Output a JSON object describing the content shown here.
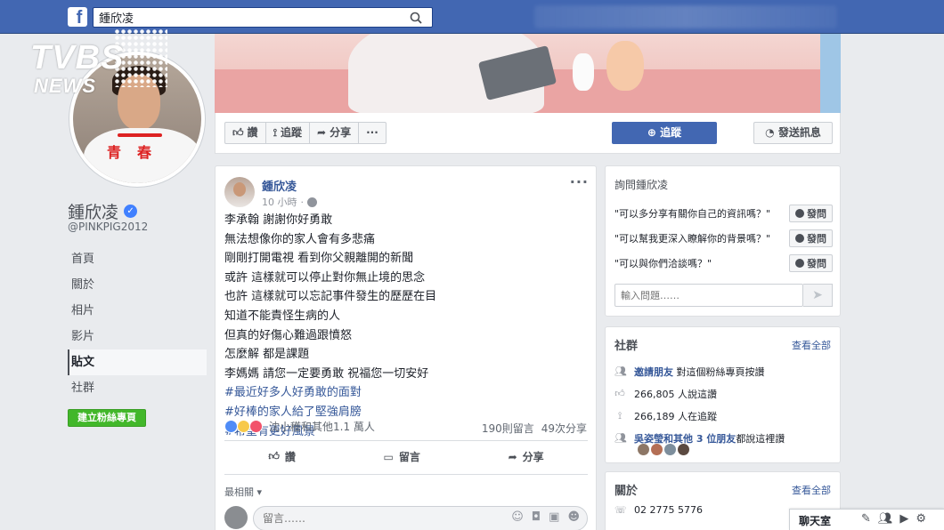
{
  "header": {
    "search_value": "鍾欣凌",
    "logo_letter": "f",
    "brand_color": "#4267b2"
  },
  "watermark": {
    "line1": "TVBS",
    "line2": "NEWS"
  },
  "profile": {
    "name": "鍾欣凌",
    "handle": "@PINKPIG2012",
    "shirt_text_1": "青",
    "shirt_text_2": "春"
  },
  "left_nav": {
    "items": [
      {
        "label": "首頁"
      },
      {
        "label": "關於"
      },
      {
        "label": "相片"
      },
      {
        "label": "影片"
      },
      {
        "label": "貼文"
      },
      {
        "label": "社群"
      }
    ],
    "create_button": "建立粉絲專頁"
  },
  "action_bar": {
    "like": "讚",
    "follow_small": "追蹤",
    "share": "分享",
    "more": "···",
    "follow_button": "追蹤",
    "message_button": "發送訊息"
  },
  "post": {
    "author": "鍾欣凌",
    "time": "10 小時",
    "lines": [
      "李承翰 謝謝你好勇敢",
      "無法想像你的家人會有多悲痛",
      "剛剛打開電視 看到你父親離開的新聞",
      "或許 這樣就可以停止對你無止境的思念",
      "也許 這樣就可以忘記事件發生的歷歷在目",
      "知道不能責怪生病的人",
      "但真的好傷心難過跟憤怒",
      "怎麼解 都是課題",
      "李媽媽 請您一定要勇敢 祝福您一切安好"
    ],
    "hashtags": [
      "#最近好多人好勇敢的面對",
      "#好棒的家人給了堅強肩膀",
      "#希望有更好風景"
    ],
    "reaction_names": "沈小穫和其他1.1 萬人",
    "comments_count": "190則留言",
    "shares_count": "49次分享",
    "like_action": "讚",
    "comment_action": "留言",
    "share_action": "分享",
    "sort_label": "最相關 ▾",
    "comment_placeholder": "留言……"
  },
  "ask_card": {
    "title": "詢問鍾欣凌",
    "questions": [
      {
        "text": "\"可以多分享有關你自己的資訊嗎？\"",
        "button": "發問"
      },
      {
        "text": "\"可以幫我更深入瞭解你的背景嗎？\"",
        "button": "發問"
      },
      {
        "text": "\"可以與你們洽談嗎？\"",
        "button": "發問"
      }
    ],
    "input_placeholder": "輸入問題……"
  },
  "community": {
    "title": "社群",
    "see_all": "查看全部",
    "invite_link": "邀請朋友",
    "invite_text": "對這個粉絲專頁按讚",
    "likes_text": "266,805 人說這讚",
    "follows_text": "266,189 人在追蹤",
    "friends_link": "吳姿瑩和其他 3 位朋友",
    "friends_text": "都說這裡讚"
  },
  "about": {
    "title": "關於",
    "see_all": "查看全部",
    "phone": "02 2775 5776"
  },
  "chat": {
    "label": "聊天室"
  }
}
